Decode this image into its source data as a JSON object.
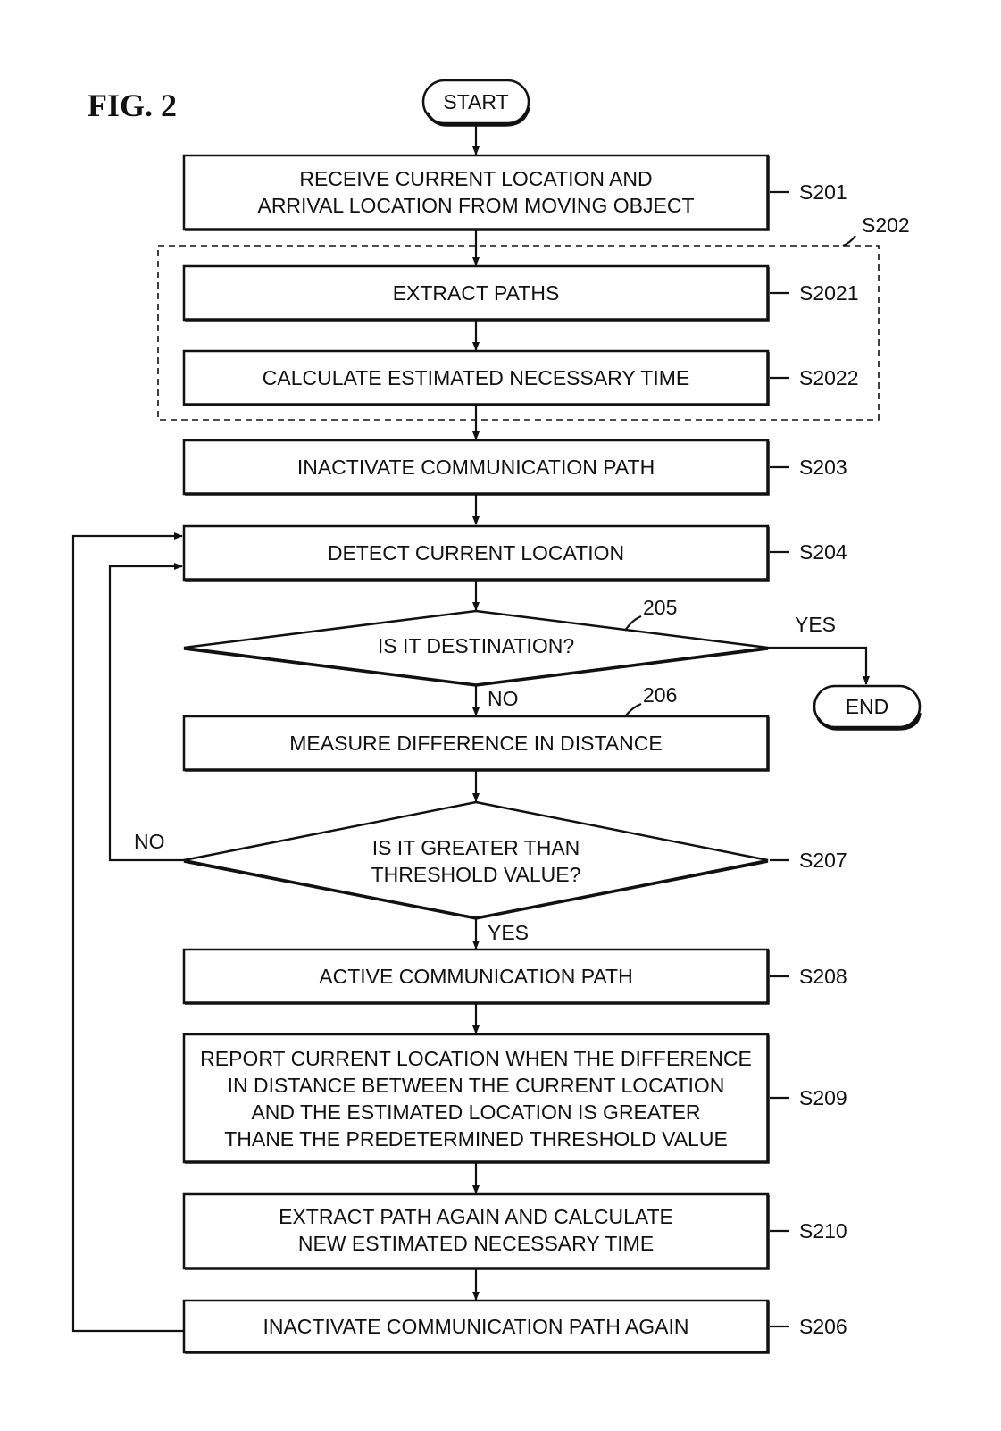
{
  "figure_title": "FIG. 2",
  "terminals": {
    "start": "START",
    "end": "END"
  },
  "steps": {
    "s201": {
      "lines": [
        "RECEIVE CURRENT LOCATION AND",
        "ARRIVAL LOCATION FROM MOVING OBJECT"
      ],
      "ref": "S201"
    },
    "s2021": {
      "lines": [
        "EXTRACT PATHS"
      ],
      "ref": "S2021"
    },
    "s2022": {
      "lines": [
        "CALCULATE ESTIMATED NECESSARY TIME"
      ],
      "ref": "S2022"
    },
    "s203": {
      "lines": [
        "INACTIVATE COMMUNICATION PATH"
      ],
      "ref": "S203"
    },
    "s204": {
      "lines": [
        "DETECT CURRENT LOCATION"
      ],
      "ref": "S204"
    },
    "d205": {
      "lines": [
        "IS IT DESTINATION?"
      ],
      "ref": "205"
    },
    "s206a": {
      "lines": [
        "MEASURE DIFFERENCE IN DISTANCE"
      ],
      "ref": "206"
    },
    "d207": {
      "lines": [
        "IS IT GREATER THAN",
        "THRESHOLD VALUE?"
      ],
      "ref": "S207"
    },
    "s208": {
      "lines": [
        "ACTIVE COMMUNICATION PATH"
      ],
      "ref": "S208"
    },
    "s209": {
      "lines": [
        "REPORT CURRENT LOCATION WHEN THE DIFFERENCE",
        "IN DISTANCE BETWEEN THE CURRENT LOCATION",
        "AND THE ESTIMATED LOCATION IS GREATER",
        "THANE THE PREDETERMINED THRESHOLD VALUE"
      ],
      "ref": "S209"
    },
    "s210": {
      "lines": [
        "EXTRACT PATH AGAIN AND CALCULATE",
        "NEW ESTIMATED NECESSARY TIME"
      ],
      "ref": "S210"
    },
    "s206b": {
      "lines": [
        "INACTIVATE COMMUNICATION PATH AGAIN"
      ],
      "ref": "S206"
    }
  },
  "group": {
    "ref": "S202"
  },
  "branches": {
    "d205_yes": "YES",
    "d205_no": "NO",
    "d207_no": "NO",
    "d207_yes": "YES"
  }
}
